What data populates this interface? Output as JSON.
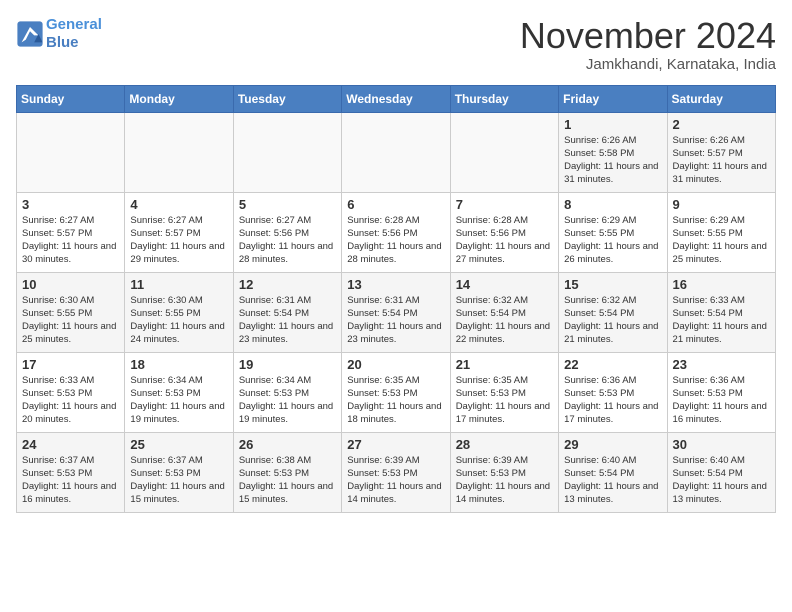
{
  "header": {
    "logo_line1": "General",
    "logo_line2": "Blue",
    "month": "November 2024",
    "location": "Jamkhandi, Karnataka, India"
  },
  "weekdays": [
    "Sunday",
    "Monday",
    "Tuesday",
    "Wednesday",
    "Thursday",
    "Friday",
    "Saturday"
  ],
  "weeks": [
    [
      {
        "day": "",
        "info": ""
      },
      {
        "day": "",
        "info": ""
      },
      {
        "day": "",
        "info": ""
      },
      {
        "day": "",
        "info": ""
      },
      {
        "day": "",
        "info": ""
      },
      {
        "day": "1",
        "info": "Sunrise: 6:26 AM\nSunset: 5:58 PM\nDaylight: 11 hours and 31 minutes."
      },
      {
        "day": "2",
        "info": "Sunrise: 6:26 AM\nSunset: 5:57 PM\nDaylight: 11 hours and 31 minutes."
      }
    ],
    [
      {
        "day": "3",
        "info": "Sunrise: 6:27 AM\nSunset: 5:57 PM\nDaylight: 11 hours and 30 minutes."
      },
      {
        "day": "4",
        "info": "Sunrise: 6:27 AM\nSunset: 5:57 PM\nDaylight: 11 hours and 29 minutes."
      },
      {
        "day": "5",
        "info": "Sunrise: 6:27 AM\nSunset: 5:56 PM\nDaylight: 11 hours and 28 minutes."
      },
      {
        "day": "6",
        "info": "Sunrise: 6:28 AM\nSunset: 5:56 PM\nDaylight: 11 hours and 28 minutes."
      },
      {
        "day": "7",
        "info": "Sunrise: 6:28 AM\nSunset: 5:56 PM\nDaylight: 11 hours and 27 minutes."
      },
      {
        "day": "8",
        "info": "Sunrise: 6:29 AM\nSunset: 5:55 PM\nDaylight: 11 hours and 26 minutes."
      },
      {
        "day": "9",
        "info": "Sunrise: 6:29 AM\nSunset: 5:55 PM\nDaylight: 11 hours and 25 minutes."
      }
    ],
    [
      {
        "day": "10",
        "info": "Sunrise: 6:30 AM\nSunset: 5:55 PM\nDaylight: 11 hours and 25 minutes."
      },
      {
        "day": "11",
        "info": "Sunrise: 6:30 AM\nSunset: 5:55 PM\nDaylight: 11 hours and 24 minutes."
      },
      {
        "day": "12",
        "info": "Sunrise: 6:31 AM\nSunset: 5:54 PM\nDaylight: 11 hours and 23 minutes."
      },
      {
        "day": "13",
        "info": "Sunrise: 6:31 AM\nSunset: 5:54 PM\nDaylight: 11 hours and 23 minutes."
      },
      {
        "day": "14",
        "info": "Sunrise: 6:32 AM\nSunset: 5:54 PM\nDaylight: 11 hours and 22 minutes."
      },
      {
        "day": "15",
        "info": "Sunrise: 6:32 AM\nSunset: 5:54 PM\nDaylight: 11 hours and 21 minutes."
      },
      {
        "day": "16",
        "info": "Sunrise: 6:33 AM\nSunset: 5:54 PM\nDaylight: 11 hours and 21 minutes."
      }
    ],
    [
      {
        "day": "17",
        "info": "Sunrise: 6:33 AM\nSunset: 5:53 PM\nDaylight: 11 hours and 20 minutes."
      },
      {
        "day": "18",
        "info": "Sunrise: 6:34 AM\nSunset: 5:53 PM\nDaylight: 11 hours and 19 minutes."
      },
      {
        "day": "19",
        "info": "Sunrise: 6:34 AM\nSunset: 5:53 PM\nDaylight: 11 hours and 19 minutes."
      },
      {
        "day": "20",
        "info": "Sunrise: 6:35 AM\nSunset: 5:53 PM\nDaylight: 11 hours and 18 minutes."
      },
      {
        "day": "21",
        "info": "Sunrise: 6:35 AM\nSunset: 5:53 PM\nDaylight: 11 hours and 17 minutes."
      },
      {
        "day": "22",
        "info": "Sunrise: 6:36 AM\nSunset: 5:53 PM\nDaylight: 11 hours and 17 minutes."
      },
      {
        "day": "23",
        "info": "Sunrise: 6:36 AM\nSunset: 5:53 PM\nDaylight: 11 hours and 16 minutes."
      }
    ],
    [
      {
        "day": "24",
        "info": "Sunrise: 6:37 AM\nSunset: 5:53 PM\nDaylight: 11 hours and 16 minutes."
      },
      {
        "day": "25",
        "info": "Sunrise: 6:37 AM\nSunset: 5:53 PM\nDaylight: 11 hours and 15 minutes."
      },
      {
        "day": "26",
        "info": "Sunrise: 6:38 AM\nSunset: 5:53 PM\nDaylight: 11 hours and 15 minutes."
      },
      {
        "day": "27",
        "info": "Sunrise: 6:39 AM\nSunset: 5:53 PM\nDaylight: 11 hours and 14 minutes."
      },
      {
        "day": "28",
        "info": "Sunrise: 6:39 AM\nSunset: 5:53 PM\nDaylight: 11 hours and 14 minutes."
      },
      {
        "day": "29",
        "info": "Sunrise: 6:40 AM\nSunset: 5:54 PM\nDaylight: 11 hours and 13 minutes."
      },
      {
        "day": "30",
        "info": "Sunrise: 6:40 AM\nSunset: 5:54 PM\nDaylight: 11 hours and 13 minutes."
      }
    ]
  ]
}
